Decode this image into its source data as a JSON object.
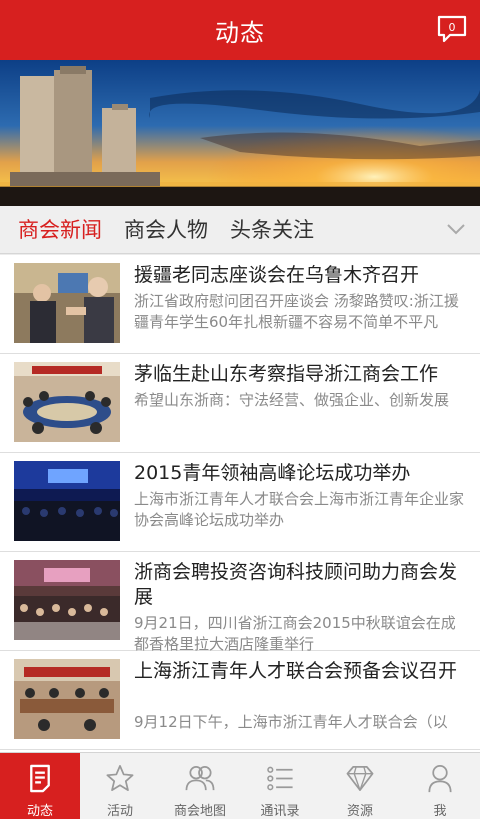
{
  "header": {
    "title": "动态",
    "message_count": "0"
  },
  "tabs": [
    {
      "label": "商会新闻"
    },
    {
      "label": "商会人物"
    },
    {
      "label": "头条关注"
    }
  ],
  "news": [
    {
      "title": "援疆老同志座谈会在乌鲁木齐召开",
      "summary": "浙江省政府慰问团召开座谈会 汤黎路赞叹:浙江援疆青年学生60年扎根新疆不容易不简单不平凡"
    },
    {
      "title": "茅临生赴山东考察指导浙江商会工作",
      "summary": "希望山东浙商：守法经营、做强企业、创新发展"
    },
    {
      "title": "2015青年领袖高峰论坛成功举办",
      "summary": "上海市浙江青年人才联合会上海市浙江青年企业家协会高峰论坛成功举办"
    },
    {
      "title": "浙商会聘投资咨询科技顾问助力商会发展",
      "summary": "9月21日，四川省浙江商会2015中秋联谊会在成都香格里拉大酒店隆重举行"
    },
    {
      "title": "上海浙江青年人才联合会预备会议召开",
      "summary": "9月12日下午，上海市浙江青年人才联合会（以"
    }
  ],
  "bottom_nav": [
    {
      "label": "动态",
      "icon": "news-icon"
    },
    {
      "label": "活动",
      "icon": "star-icon"
    },
    {
      "label": "商会地图",
      "icon": "people-icon"
    },
    {
      "label": "通讯录",
      "icon": "list-icon"
    },
    {
      "label": "资源",
      "icon": "diamond-icon"
    },
    {
      "label": "我",
      "icon": "person-icon"
    }
  ],
  "colors": {
    "brand": "#d7201f",
    "background": "#ececec",
    "summary_text": "#8a8a8a"
  }
}
